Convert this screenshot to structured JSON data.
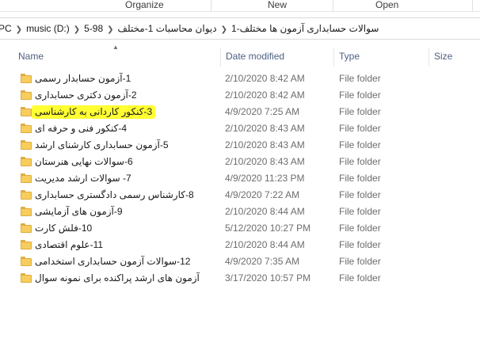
{
  "ribbon": {
    "groups": [
      "Organize",
      "New",
      "Open"
    ]
  },
  "address": {
    "crumbs": [
      "PC",
      "music (D:)",
      "5-98",
      "دیوان محاسبات 1-مختلف",
      "سوالات حسابداری آزمون ها مختلف-1"
    ]
  },
  "columns": {
    "name": "Name",
    "date": "Date modified",
    "type": "Type",
    "size": "Size"
  },
  "icons": {
    "folder": "folder-icon",
    "sort": "sort-ascending-icon"
  },
  "colors": {
    "highlight": "#ffff33",
    "folder": "#f7cd5e",
    "header_text": "#4d6082"
  },
  "files": [
    {
      "name": "1-آزمون حسابدار رسمی",
      "date": "2/10/2020 8:42 AM",
      "type": "File folder"
    },
    {
      "name": "2-آزمون دکتری حسابداری",
      "date": "2/10/2020 8:42 AM",
      "type": "File folder"
    },
    {
      "name": "3-کنکور کاردانی به کارشناسی",
      "date": "4/9/2020 7:25 AM",
      "type": "File folder"
    },
    {
      "name": "4-کنکور فنی  و حرفه ای",
      "date": "2/10/2020 8:43 AM",
      "type": "File folder"
    },
    {
      "name": "5-آزمون حسابداری کارشنای ارشد",
      "date": "2/10/2020 8:43 AM",
      "type": "File folder"
    },
    {
      "name": "6-سوالات نهایی هنرستان",
      "date": "2/10/2020 8:43 AM",
      "type": "File folder"
    },
    {
      "name": "7- سوالات ارشد مدیریت",
      "date": "4/9/2020 11:23 PM",
      "type": "File folder"
    },
    {
      "name": "8-کارشناس رسمی دادگستری حسابداری",
      "date": "4/9/2020 7:22 AM",
      "type": "File folder"
    },
    {
      "name": "9-آزمون های آزمایشی",
      "date": "2/10/2020 8:44 AM",
      "type": "File folder"
    },
    {
      "name": "10-فلش کارت",
      "date": "5/12/2020 10:27 PM",
      "type": "File folder"
    },
    {
      "name": "11-علوم اقتصادی",
      "date": "2/10/2020 8:44 AM",
      "type": "File folder"
    },
    {
      "name": "12-سوالات آزمون حسابداری استخدامی",
      "date": "4/9/2020 7:35 AM",
      "type": "File folder"
    },
    {
      "name": "آزمون های ارشد پراکنده برای نمونه سوال",
      "date": "3/17/2020 10:57 PM",
      "type": "File folder"
    }
  ]
}
